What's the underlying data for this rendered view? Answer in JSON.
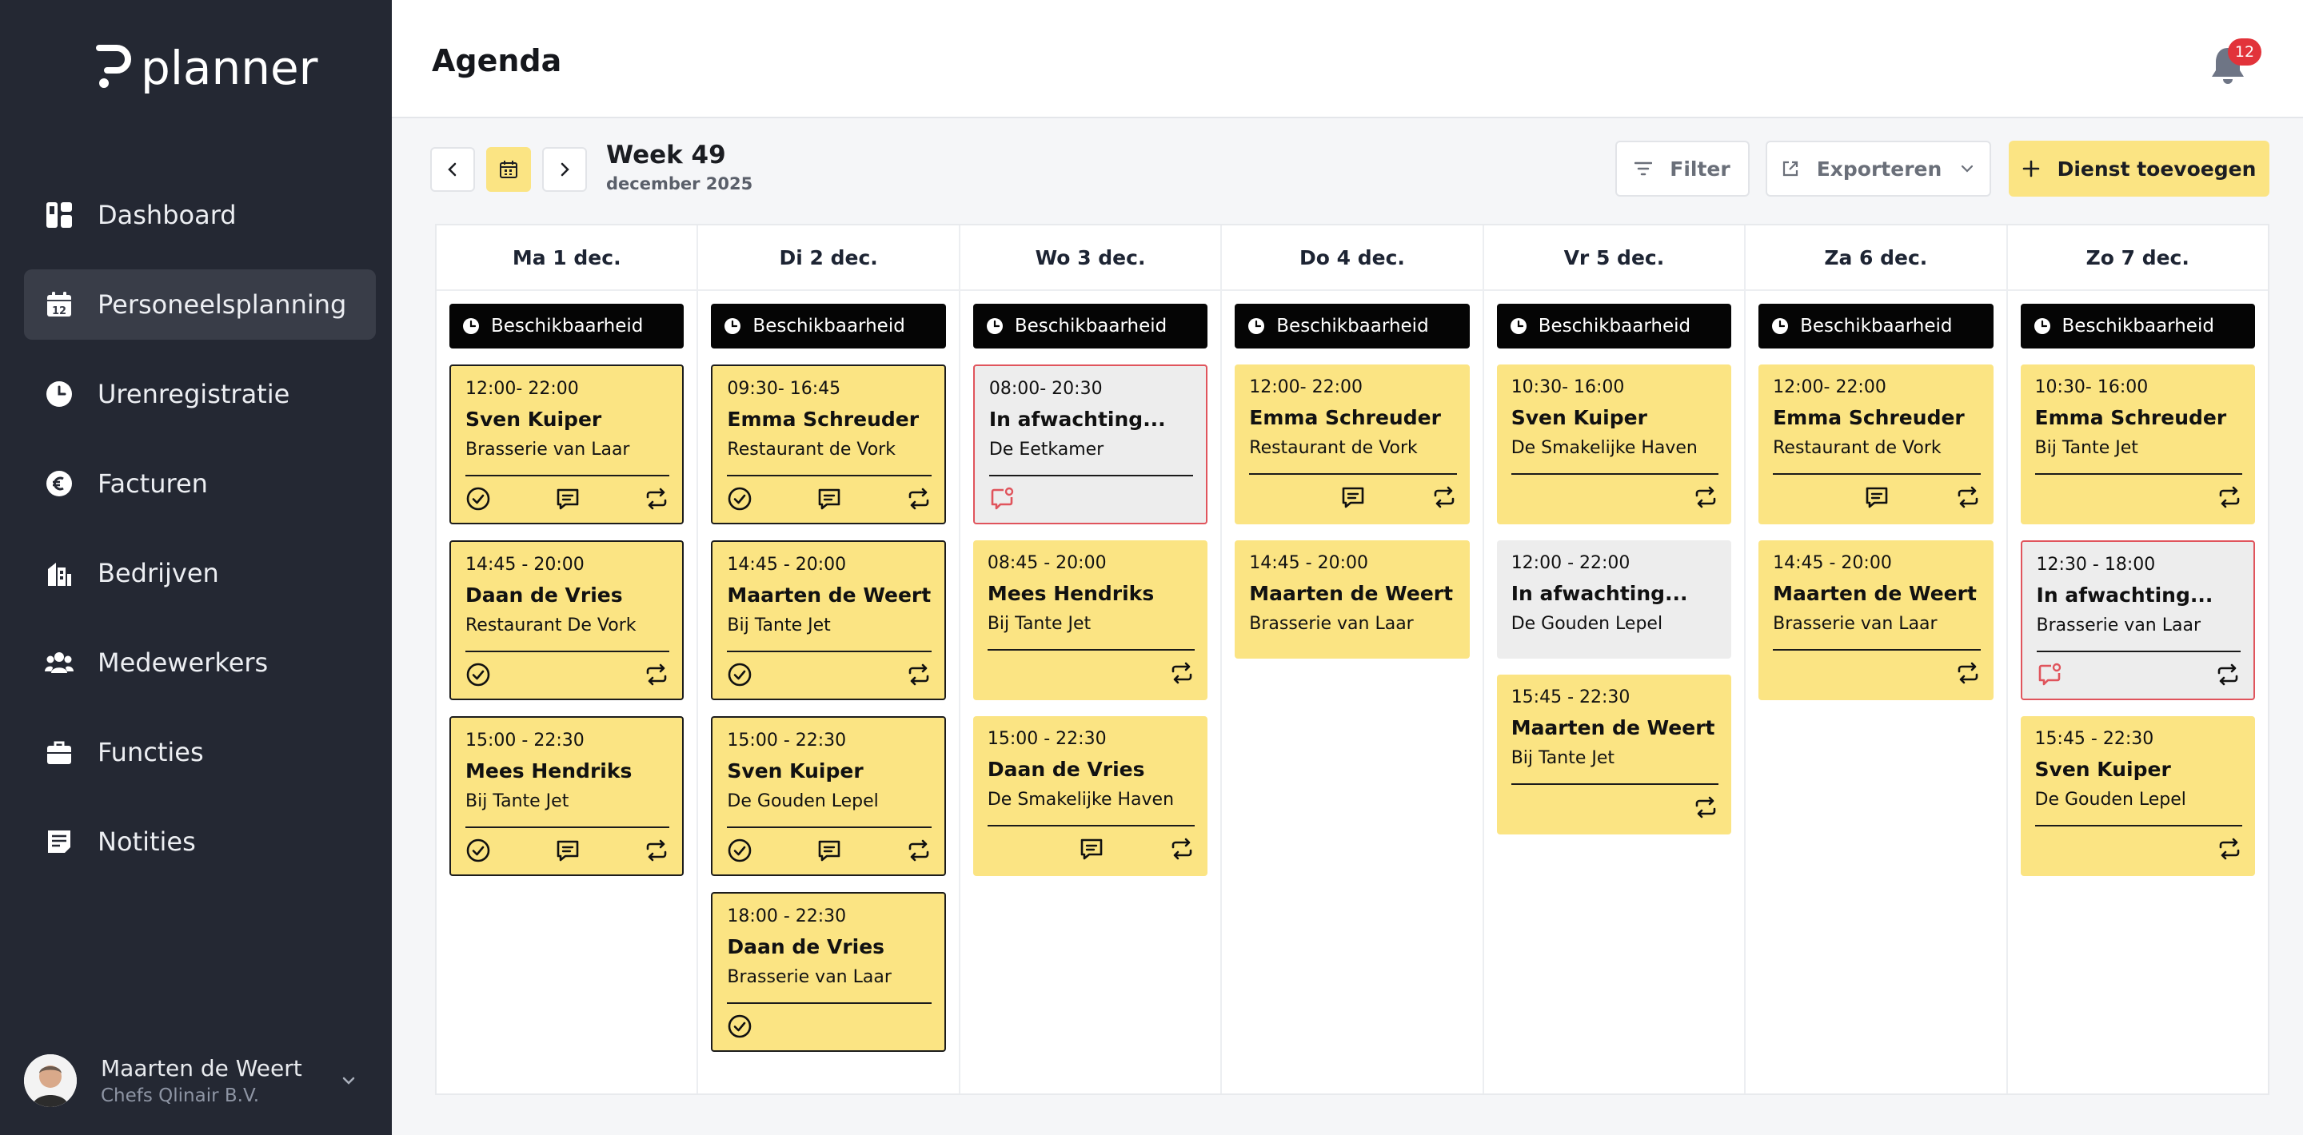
{
  "app": {
    "logo_text": "planner"
  },
  "sidebar": {
    "items": [
      {
        "label": "Dashboard",
        "icon": "dashboard-icon",
        "active": false
      },
      {
        "label": "Personeelsplanning",
        "icon": "calendar-icon",
        "active": true
      },
      {
        "label": "Urenregistratie",
        "icon": "clock-icon",
        "active": false
      },
      {
        "label": "Facturen",
        "icon": "euro-icon",
        "active": false
      },
      {
        "label": "Bedrijven",
        "icon": "building-icon",
        "active": false
      },
      {
        "label": "Medewerkers",
        "icon": "users-icon",
        "active": false
      },
      {
        "label": "Functies",
        "icon": "briefcase-icon",
        "active": false
      },
      {
        "label": "Notities",
        "icon": "notes-icon",
        "active": false
      }
    ],
    "user": {
      "name": "Maarten de Weert",
      "company": "Chefs Qlinair B.V."
    }
  },
  "header": {
    "title": "Agenda",
    "notification_count": "12"
  },
  "toolbar": {
    "week_title": "Week 49",
    "week_subtitle": "december 2025",
    "filter_label": "Filter",
    "export_label": "Exporteren",
    "add_label": "Dienst toevoegen"
  },
  "colors": {
    "sidebar": "#242833",
    "accent": "#fbe483",
    "pending_border": "#e0545c",
    "badge": "#e2333a"
  },
  "availability_label": "Beschikbaarheid",
  "days": [
    {
      "label": "Ma 1 dec.",
      "shifts": [
        {
          "time": "12:00- 22:00",
          "name": "Sven Kuiper",
          "place": "Brasserie van Laar",
          "status": "confirmed",
          "icons": [
            "check",
            "chat",
            "swap"
          ]
        },
        {
          "time": "14:45 - 20:00",
          "name": "Daan de Vries",
          "place": "Restaurant De Vork",
          "status": "confirmed",
          "icons": [
            "check",
            "swap"
          ]
        },
        {
          "time": "15:00 - 22:30",
          "name": "Mees Hendriks",
          "place": "Bij Tante Jet",
          "status": "confirmed",
          "icons": [
            "check",
            "chat",
            "swap"
          ]
        }
      ]
    },
    {
      "label": "Di 2 dec.",
      "shifts": [
        {
          "time": "09:30- 16:45",
          "name": "Emma Schreuder",
          "place": "Restaurant de Vork",
          "status": "confirmed",
          "icons": [
            "check",
            "chat",
            "swap"
          ]
        },
        {
          "time": "14:45 - 20:00",
          "name": "Maarten de Weert",
          "place": "Bij Tante Jet",
          "status": "confirmed",
          "icons": [
            "check",
            "swap"
          ]
        },
        {
          "time": "15:00 - 22:30",
          "name": "Sven Kuiper",
          "place": "De Gouden Lepel",
          "status": "confirmed",
          "icons": [
            "check",
            "chat",
            "swap"
          ]
        },
        {
          "time": "18:00 - 22:30",
          "name": "Daan de Vries",
          "place": "Brasserie van Laar",
          "status": "confirmed",
          "icons": [
            "check"
          ]
        }
      ]
    },
    {
      "label": "Wo 3 dec.",
      "shifts": [
        {
          "time": "08:00- 20:30",
          "name": "In afwachting...",
          "place": "De Eetkamer",
          "status": "pending",
          "icons": [
            "alert"
          ]
        },
        {
          "time": "08:45 - 20:00",
          "name": "Mees Hendriks",
          "place": "Bij Tante Jet",
          "status": "open",
          "icons": [
            "swap"
          ]
        },
        {
          "time": "15:00 - 22:30",
          "name": "Daan de Vries",
          "place": "De Smakelijke Haven",
          "status": "open",
          "icons": [
            "chat",
            "swap"
          ]
        }
      ]
    },
    {
      "label": "Do 4 dec.",
      "shifts": [
        {
          "time": "12:00- 22:00",
          "name": "Emma Schreuder",
          "place": "Restaurant de Vork",
          "status": "open",
          "icons": [
            "chat",
            "swap"
          ]
        },
        {
          "time": "14:45 - 20:00",
          "name": "Maarten de Weert",
          "place": "Brasserie van Laar",
          "status": "open-short",
          "icons": []
        }
      ]
    },
    {
      "label": "Vr 5 dec.",
      "shifts": [
        {
          "time": "10:30- 16:00",
          "name": "Sven Kuiper",
          "place": "De Smakelijke Haven",
          "status": "open",
          "icons": [
            "swap"
          ]
        },
        {
          "time": "12:00 - 22:00",
          "name": "In afwachting...",
          "place": "De Gouden Lepel",
          "status": "pending-plain",
          "icons": []
        },
        {
          "time": "15:45 - 22:30",
          "name": "Maarten de Weert",
          "place": "Bij Tante Jet",
          "status": "open",
          "icons": [
            "swap"
          ]
        }
      ]
    },
    {
      "label": "Za 6 dec.",
      "shifts": [
        {
          "time": "12:00- 22:00",
          "name": "Emma Schreuder",
          "place": "Restaurant de Vork",
          "status": "open",
          "icons": [
            "chat",
            "swap"
          ]
        },
        {
          "time": "14:45 - 20:00",
          "name": "Maarten de Weert",
          "place": "Brasserie van Laar",
          "status": "open",
          "icons": [
            "swap"
          ]
        }
      ]
    },
    {
      "label": "Zo 7 dec.",
      "shifts": [
        {
          "time": "10:30- 16:00",
          "name": "Emma Schreuder",
          "place": "Bij Tante Jet",
          "status": "open",
          "icons": [
            "swap"
          ]
        },
        {
          "time": "12:30 - 18:00",
          "name": "In afwachting...",
          "place": "Brasserie van Laar",
          "status": "pending",
          "icons": [
            "alert",
            "swap"
          ]
        },
        {
          "time": "15:45 - 22:30",
          "name": "Sven Kuiper",
          "place": "De Gouden Lepel",
          "status": "open",
          "icons": [
            "swap"
          ]
        }
      ]
    }
  ]
}
